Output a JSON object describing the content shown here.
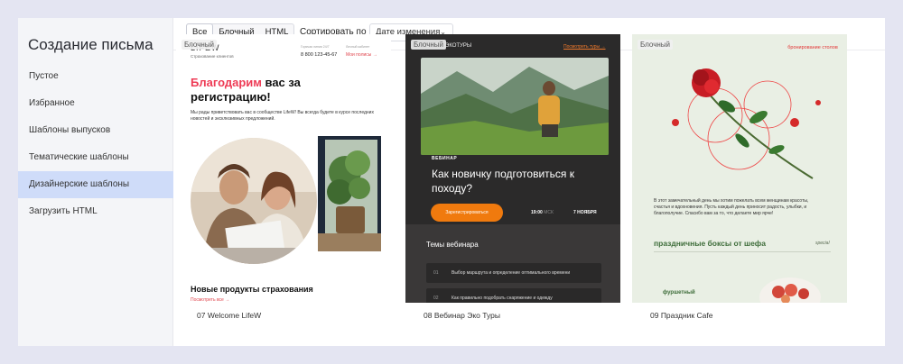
{
  "sidebar": {
    "title": "Создание письма",
    "items": [
      {
        "label": "Пустое"
      },
      {
        "label": "Избранное"
      },
      {
        "label": "Шаблоны выпусков"
      },
      {
        "label": "Тематические шаблоны"
      },
      {
        "label": "Дизайнерские шаблоны",
        "active": true
      },
      {
        "label": "Загрузить HTML"
      }
    ]
  },
  "toolbar": {
    "filters": [
      "Все",
      "Блочный",
      "HTML"
    ],
    "active_filter": "Все",
    "sort_label": "Сортировать по",
    "sort_value": "Дате изменения"
  },
  "cards": [
    {
      "badge": "Блочный",
      "caption": "07 Welcome LifeW",
      "preview": {
        "logo": "LIFEW",
        "logo_sub": "Страхование клиентов",
        "phone_label": "Горячая линия 24/7",
        "phone": "8 800 123-45-67",
        "account_label": "Личный кабинет",
        "account": "Мои полисы →",
        "headline_red": "Благодарим",
        "headline_rest": " вас за регистрацию!",
        "body": "Мы рады приветствовать вас в сообществе LifeW! Вы всегда будете в курсе последних новостей и эксклюзивных предложений.",
        "section": "Новые продукты страхования",
        "more": "Посмотреть все →"
      }
    },
    {
      "badge": "Блочный",
      "caption": "08 Вебинар Эко Туры",
      "preview": {
        "logo": "ЭКОТУРЫ",
        "top_link": "Посмотреть туры →",
        "eyebrow": "ВЕБИНАР",
        "title": "Как новичку подготовиться к походу?",
        "button": "Зарегистрироваться",
        "time": "19:00",
        "tz": "МСК",
        "date": "7 НОЯБРЯ",
        "topics_title": "Темы вебинара",
        "topics": [
          {
            "n": "01",
            "text": "Выбор маршрута и определение оптимального времени"
          },
          {
            "n": "02",
            "text": "Как правильно подобрать снаряжение и одежду"
          }
        ]
      }
    },
    {
      "badge": "Блочный",
      "caption": "09 Праздник Cafe",
      "preview": {
        "brand": "бронирование столов",
        "text": "В этот замечательный день мы хотим пожелать всем женщинам красоты, счастья и вдохновения. Пусть каждый день приносит радость, улыбки, и благополучие. Спасибо вам за то, что делаете мир ярче!",
        "boxes": "праздничные боксы от шефа",
        "special": "special",
        "item": "фуршетный"
      }
    }
  ],
  "colors": {
    "accent_blue": "#cfdcf9",
    "red": "#ee3b55",
    "orange": "#f07a0e",
    "green": "#3e6d3a"
  }
}
